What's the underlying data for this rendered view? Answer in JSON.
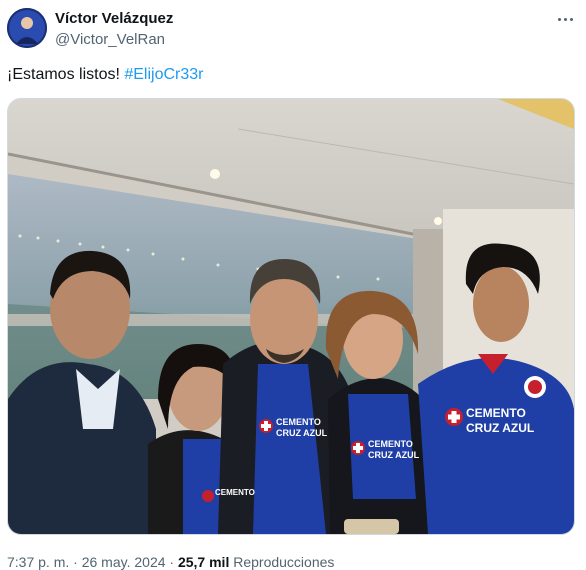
{
  "author": {
    "display_name": "Víctor Velázquez",
    "handle": "@Victor_VelRan"
  },
  "tweet": {
    "text": "¡Estamos listos! ",
    "hashtag": "#ElijoCr33r"
  },
  "media": {
    "jersey_text_line1": "CEMENTO",
    "jersey_text_line2": "CRUZ AZUL",
    "jersey_color": "#1f3fa6"
  },
  "meta": {
    "time": "7:37 p. m.",
    "separator": " · ",
    "date": "26 may. 2024",
    "views_count": "25,7 mil",
    "views_label": " Reproducciones"
  },
  "icons": {
    "more": "more-options-icon"
  }
}
